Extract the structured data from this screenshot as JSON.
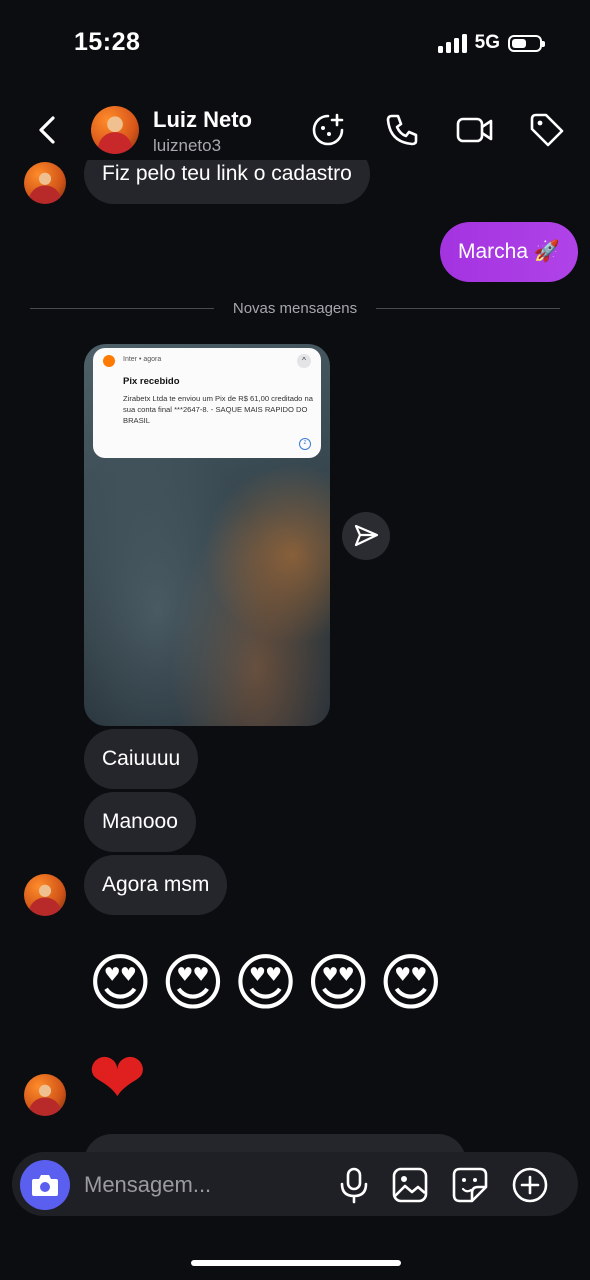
{
  "status_bar": {
    "time": "15:28",
    "network": "5G",
    "battery_level": 0.45
  },
  "header": {
    "name": "Luiz Neto",
    "handle": "luizneto3",
    "icons": [
      "sticker-game-icon",
      "phone-icon",
      "video-icon",
      "tag-icon"
    ]
  },
  "messages": {
    "cut_in_text": "Fiz pelo teu link o cadastro",
    "outgoing_1": "Marcha 🚀",
    "divider_label": "Novas mensagens",
    "notification": {
      "app": "Inter • agora",
      "chevron": "^",
      "title": "Pix recebido",
      "body": "Zirabetx Ltda te enviou um Pix de R$ 61,00 creditado na sua conta final ***2647-8. - SAQUE MAIS RAPIDO DO BRASIL",
      "snooze": "z"
    },
    "incoming_1": "Caiuuuu",
    "incoming_2": "Manooo",
    "incoming_3": "Agora msm",
    "emoji_reaction": "😍😍😍😍😍",
    "heart": "❤"
  },
  "composer": {
    "placeholder": "Mensagem..."
  },
  "colors": {
    "accent": "#a333e0",
    "camera": "#5b5ff0",
    "bubble_in": "#25262c",
    "background": "#0c0d11"
  }
}
